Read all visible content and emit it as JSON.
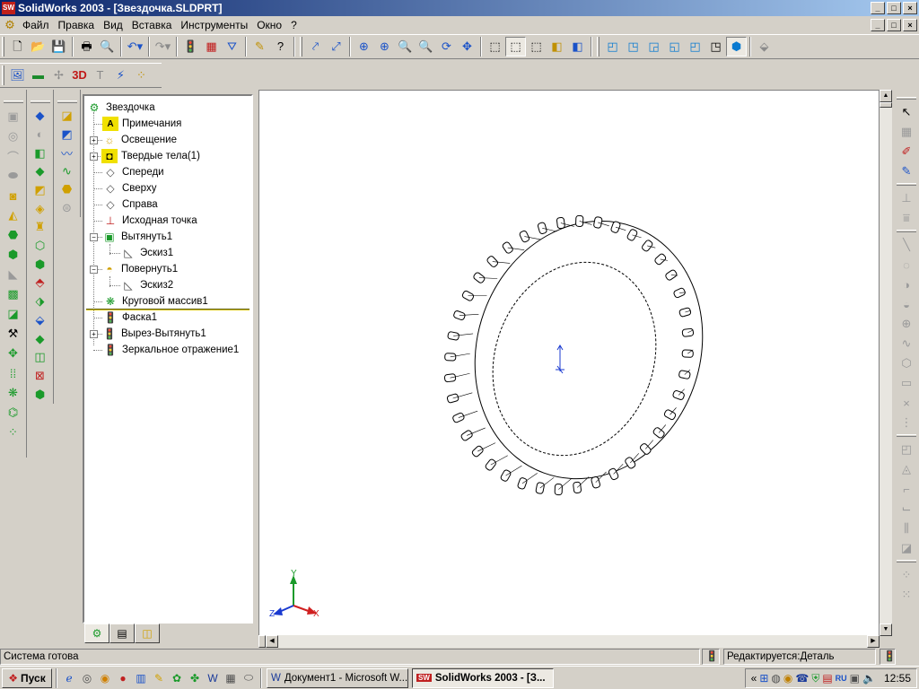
{
  "window": {
    "title": "SolidWorks 2003 - [Звездочка.SLDPRT]",
    "app_icon_label": "SW",
    "controls": [
      "_",
      "□",
      "×"
    ]
  },
  "menu": {
    "items": [
      "Файл",
      "Правка",
      "Вид",
      "Вставка",
      "Инструменты",
      "Окно",
      "?"
    ]
  },
  "tree": {
    "root": "Звездочка",
    "nodes": [
      {
        "label": "Примечания",
        "icon": "annotations-icon"
      },
      {
        "label": "Освещение",
        "icon": "lighting-icon"
      },
      {
        "label": "Твердые тела(1)",
        "icon": "solid-bodies-icon"
      },
      {
        "label": "Спереди",
        "icon": "plane-icon"
      },
      {
        "label": "Сверху",
        "icon": "plane-icon"
      },
      {
        "label": "Справа",
        "icon": "plane-icon"
      },
      {
        "label": "Исходная точка",
        "icon": "origin-icon"
      },
      {
        "label": "Вытянуть1",
        "icon": "extrude-icon"
      },
      {
        "label": "Эскиз1",
        "icon": "sketch-icon"
      },
      {
        "label": "Повернуть1",
        "icon": "revolve-icon"
      },
      {
        "label": "Эскиз2",
        "icon": "sketch-icon"
      },
      {
        "label": "Круговой массив1",
        "icon": "circular-pattern-icon"
      },
      {
        "label": "Фаска1",
        "icon": "chamfer-icon"
      },
      {
        "label": "Вырез-Вытянуть1",
        "icon": "cut-extrude-icon"
      },
      {
        "label": "Зеркальное отражение1",
        "icon": "mirror-icon"
      }
    ]
  },
  "triad": {
    "x": "X",
    "y": "Y",
    "z": "Z"
  },
  "status": {
    "left": "Система готова",
    "right": "Редактируется:Деталь"
  },
  "taskbar": {
    "start": "Пуск",
    "tasks": [
      "Документ1 - Microsoft W...",
      "SolidWorks 2003 - [З..."
    ],
    "clock": "12:55",
    "lang": "RU"
  },
  "colors": {
    "title_start": "#0a246a",
    "title_end": "#a6caf0",
    "rollback_bar": "#d4c000"
  }
}
